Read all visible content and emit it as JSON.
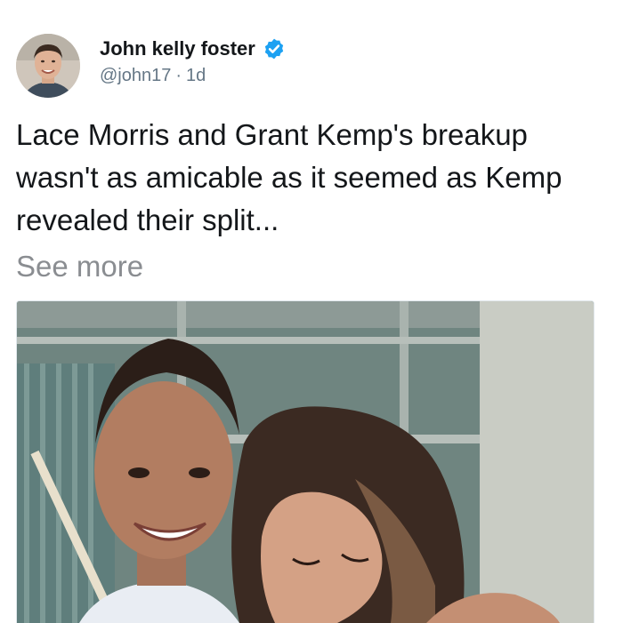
{
  "tweet": {
    "author": {
      "display_name": "John kelly foster",
      "handle": "@john17",
      "verified": true
    },
    "timestamp": "1d",
    "separator": "·",
    "text": "Lace Morris and Grant Kemp's breakup wasn't as amicable as it seemed as Kemp revealed their split...",
    "see_more_label": "See more",
    "media": {
      "type": "photo",
      "alt": "Man and woman embracing and smiling"
    }
  },
  "colors": {
    "verified_badge": "#1da1f2",
    "secondary_text": "#657786",
    "see_more": "#8a8d91"
  },
  "icons": {
    "verified": "verified-badge-icon"
  }
}
